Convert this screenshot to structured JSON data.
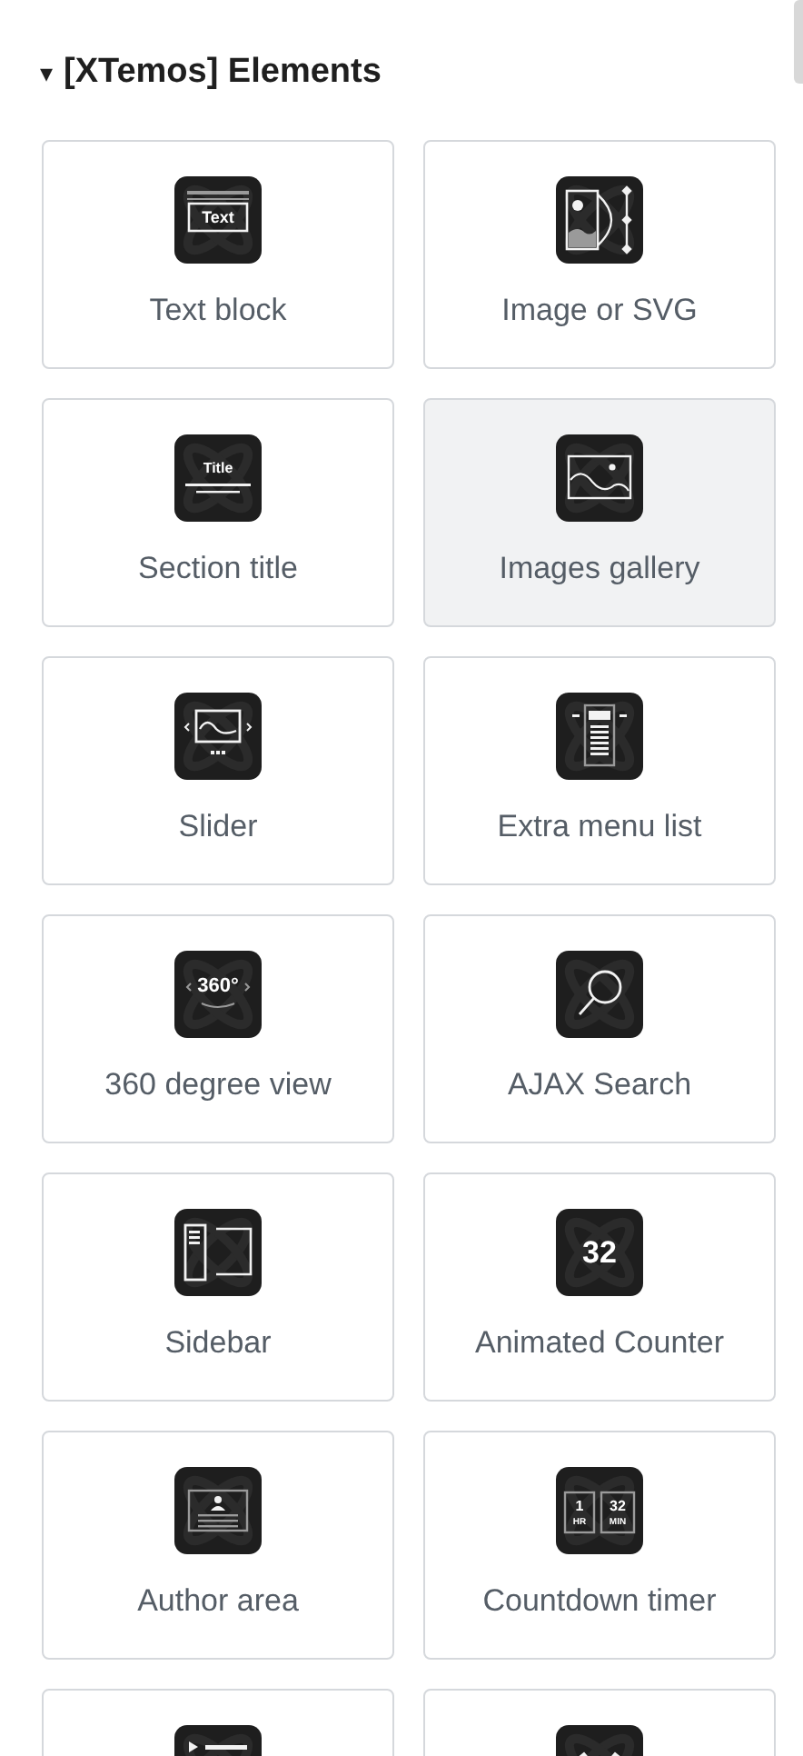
{
  "section": {
    "title": "[XTemos] Elements",
    "toggle": "▾",
    "expanded": true
  },
  "rows": [
    {
      "cards": [
        {
          "label": "Text block",
          "kind": "text",
          "icon_texts": [
            "Text"
          ],
          "selected": false
        },
        {
          "label": "Image or SVG",
          "kind": "image",
          "selected": false
        }
      ]
    },
    {
      "cards": [
        {
          "label": "Section title",
          "kind": "title",
          "icon_texts": [
            "Title"
          ],
          "selected": false
        },
        {
          "label": "Images gallery",
          "kind": "gallery",
          "selected": true
        }
      ]
    },
    {
      "cards": [
        {
          "label": "Slider",
          "kind": "slider",
          "selected": false
        },
        {
          "label": "Extra menu list",
          "kind": "menu",
          "selected": false
        }
      ]
    },
    {
      "cards": [
        {
          "label": "360 degree view",
          "kind": "degree",
          "icon_texts": [
            "360°"
          ],
          "selected": false
        },
        {
          "label": "AJAX Search",
          "kind": "search",
          "selected": false
        }
      ]
    },
    {
      "cards": [
        {
          "label": "Sidebar",
          "kind": "sidebar",
          "selected": false
        },
        {
          "label": "Animated Counter",
          "kind": "counter",
          "icon_texts": [
            "32"
          ],
          "selected": false
        }
      ]
    },
    {
      "cards": [
        {
          "label": "Author area",
          "kind": "author",
          "selected": false
        },
        {
          "label": "Countdown timer",
          "kind": "countdown",
          "icon_texts": [
            "1",
            "HR",
            "32",
            "MIN"
          ],
          "selected": false
        }
      ]
    },
    {
      "cards": [
        {
          "kind": "play",
          "selected": false
        },
        {
          "kind": "cross",
          "selected": false
        }
      ]
    }
  ]
}
